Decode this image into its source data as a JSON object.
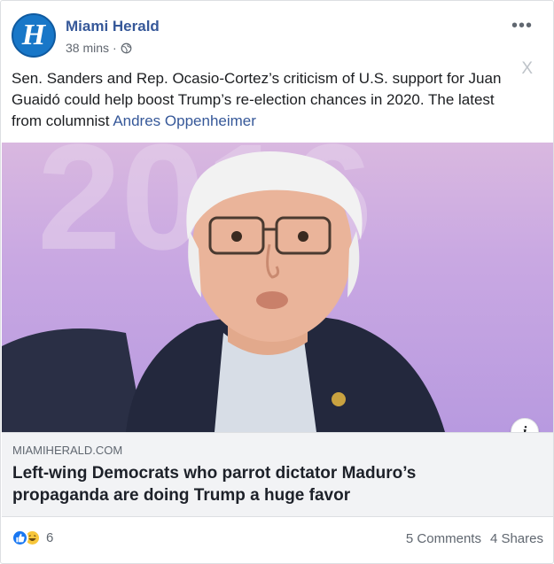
{
  "post": {
    "page_name": "Miami Herald",
    "avatar_letter": "H",
    "time": "38 mins",
    "separator": "·",
    "more_icon": "•••",
    "close_label": "X",
    "text_before_link": "Sen. Sanders and Rep. Ocasio-Cortez’s criticism of U.S. support for Juan Guaidó could help boost Trump’s re-election chances in 2020. The latest from columnist ",
    "text_link": "Andres Oppenheimer"
  },
  "preview": {
    "info_label": "i",
    "domain": "MIAMIHERALD.COM",
    "headline": "Left-wing Democrats who parrot dictator Maduro’s propaganda are doing Trump a huge favor"
  },
  "footer": {
    "reaction_count": "6",
    "comments": "5 Comments",
    "shares": "4 Shares"
  },
  "colors": {
    "link": "#365899",
    "brand_blue": "#1877c8",
    "like_blue": "#1877f2",
    "haha_yellow": "#f7c63b"
  },
  "icons": [
    "miami-herald-logo-icon",
    "globe-icon",
    "more-options-icon",
    "close-icon",
    "info-icon",
    "like-reaction-icon",
    "haha-reaction-icon"
  ]
}
